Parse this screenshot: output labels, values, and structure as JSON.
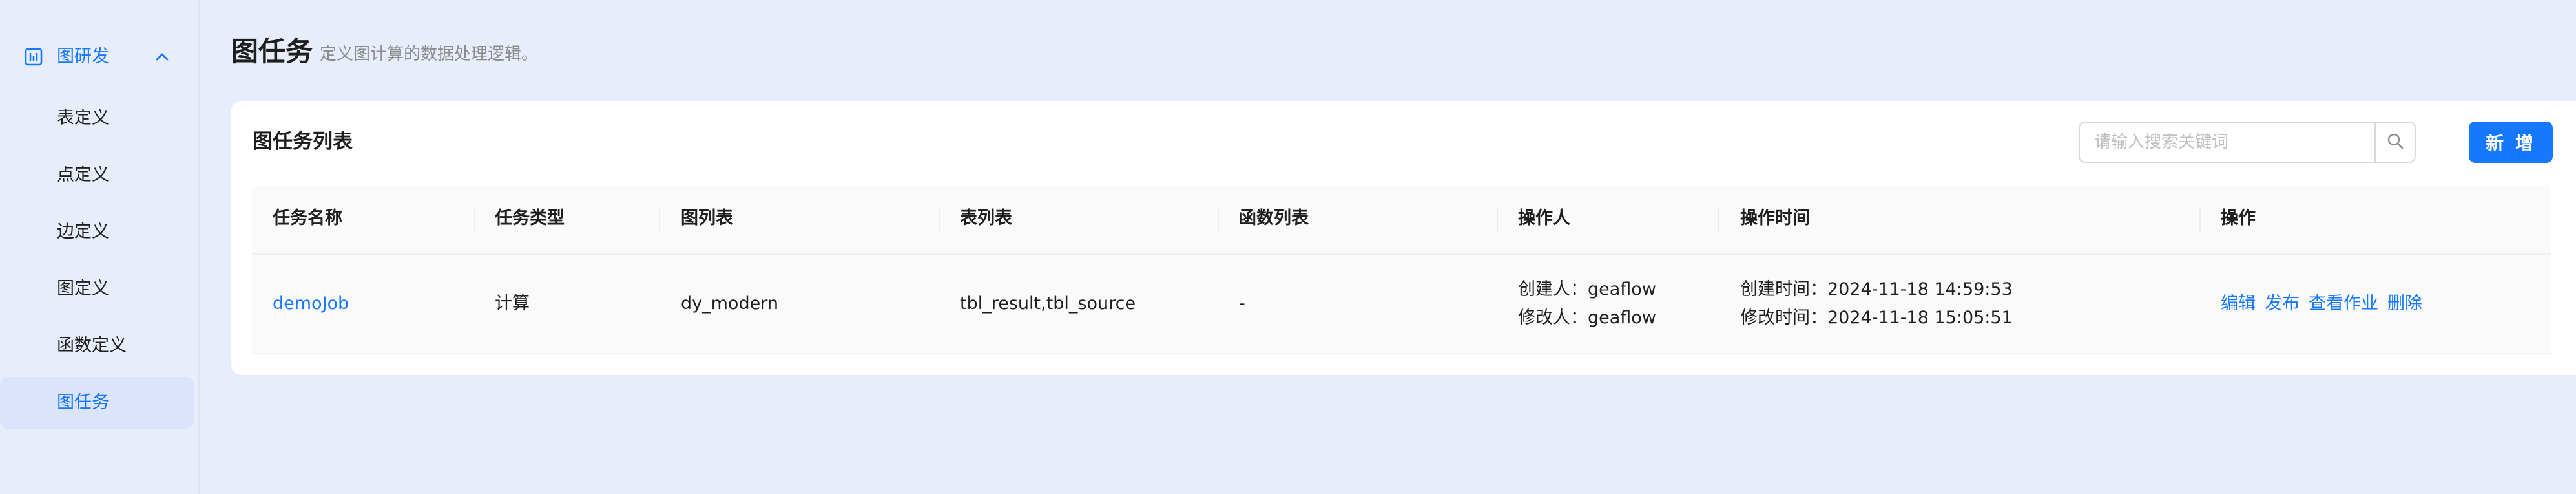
{
  "sidebar": {
    "group": {
      "label": "图研发",
      "icon": "chart-box-icon",
      "expand_icon": "chevron-up-icon"
    },
    "items": [
      {
        "label": "表定义",
        "active": false
      },
      {
        "label": "点定义",
        "active": false
      },
      {
        "label": "边定义",
        "active": false
      },
      {
        "label": "图定义",
        "active": false
      },
      {
        "label": "函数定义",
        "active": false
      },
      {
        "label": "图任务",
        "active": true
      }
    ]
  },
  "header": {
    "title": "图任务",
    "subtitle": "定义图计算的数据处理逻辑。"
  },
  "card": {
    "title": "图任务列表",
    "search": {
      "placeholder": "请输入搜索关键词",
      "icon": "search-icon"
    },
    "new_button": "新 增"
  },
  "table": {
    "columns": [
      "任务名称",
      "任务类型",
      "图列表",
      "表列表",
      "函数列表",
      "操作人",
      "操作时间",
      "操作"
    ],
    "rows": [
      {
        "name": "demoJob",
        "type": "计算",
        "graphs": "dy_modern",
        "tables": "tbl_result,tbl_source",
        "functions": "-",
        "creator": "创建人：geaflow",
        "modifier": "修改人：geaflow",
        "created_time": "创建时间：2024-11-18 14:59:53",
        "modified_time": "修改时间：2024-11-18 15:05:51",
        "actions": [
          "编辑",
          "发布",
          "查看作业",
          "删除"
        ]
      }
    ]
  },
  "colors": {
    "accent": "#1677ff",
    "page_bg": "#e8edfc",
    "active_menu_bg": "#dce4fb"
  }
}
